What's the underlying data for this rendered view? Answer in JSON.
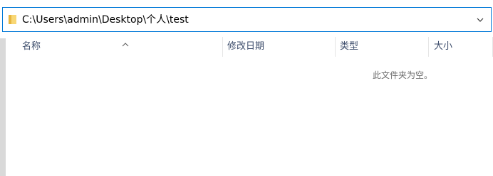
{
  "address_bar": {
    "path": "C:\\Users\\admin\\Desktop\\个人\\test",
    "folder_icon": "folder-icon",
    "dropdown_icon": "chevron-down-icon"
  },
  "columns": [
    {
      "label": "名称"
    },
    {
      "label": "修改日期"
    },
    {
      "label": "类型"
    },
    {
      "label": "大小"
    }
  ],
  "sort_indicator": "sort-ascending-icon",
  "empty_message": "此文件夹为空。",
  "colors": {
    "accent_border": "#0078d7",
    "header_text": "#3c4c6b",
    "folder_yellow": "#f8d775",
    "empty_text": "#6d6d6d"
  }
}
